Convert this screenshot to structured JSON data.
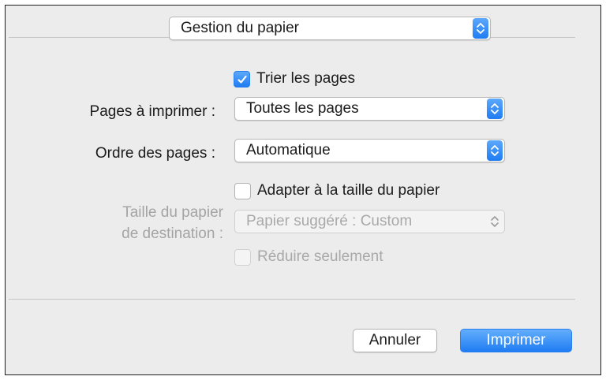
{
  "preset": {
    "value": "Gestion du papier"
  },
  "collate": {
    "label": "Trier les pages",
    "checked": true
  },
  "pages_to_print": {
    "label": "Pages à imprimer :",
    "value": "Toutes les pages"
  },
  "page_order": {
    "label": "Ordre des pages :",
    "value": "Automatique"
  },
  "scale_to_fit": {
    "label": "Adapter à la taille du papier",
    "checked": false
  },
  "destination_paper": {
    "label_line1": "Taille du papier",
    "label_line2": "de destination :",
    "value": "Papier suggéré : Custom",
    "enabled": false
  },
  "scale_down_only": {
    "label": "Réduire seulement",
    "checked": false,
    "enabled": false
  },
  "buttons": {
    "cancel": "Annuler",
    "print": "Imprimer"
  },
  "colors": {
    "accent": "#1f7cf2",
    "dialog_bg": "#ececec",
    "disabled_text": "#a9a9a9"
  }
}
